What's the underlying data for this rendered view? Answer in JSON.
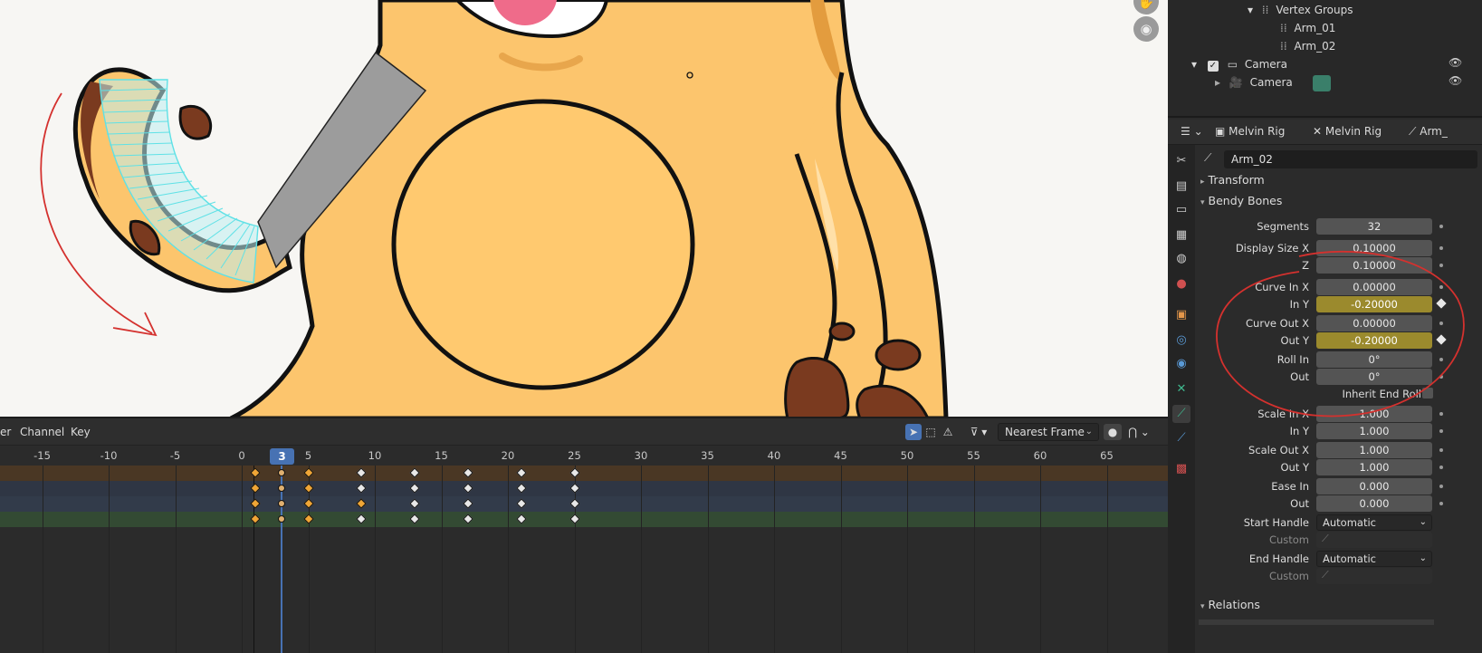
{
  "outliner": {
    "vertex_groups_label": "Vertex Groups",
    "vg_item_1": "Arm_01",
    "vg_item_2": "Arm_02",
    "camera_collection": "Camera",
    "camera_object": "Camera"
  },
  "properties_header": {
    "crumb_1": "Melvin Rig",
    "crumb_2": "Melvin Rig",
    "crumb_3": "Arm_"
  },
  "bone": {
    "name": "Arm_02"
  },
  "panels": {
    "transform": "Transform",
    "bendy_bones": "Bendy Bones",
    "relations": "Relations"
  },
  "bendy": {
    "segments_label": "Segments",
    "segments": "32",
    "display_size_x_label": "Display Size X",
    "display_size_x": "0.10000",
    "z_label": "Z",
    "z": "0.10000",
    "curve_in_x_label": "Curve In X",
    "curve_in_x": "0.00000",
    "curve_in_y_label": "In Y",
    "curve_in_y": "-0.20000",
    "curve_out_x_label": "Curve Out X",
    "curve_out_x": "0.00000",
    "curve_out_y_label": "Out Y",
    "curve_out_y": "-0.20000",
    "roll_in_label": "Roll In",
    "roll_in": "0°",
    "roll_out_label": "Out",
    "roll_out": "0°",
    "inherit_end_roll_label": "Inherit End Roll",
    "scale_in_x_label": "Scale In X",
    "scale_in_x": "1.000",
    "scale_in_y_label": "In Y",
    "scale_in_y": "1.000",
    "scale_out_x_label": "Scale Out X",
    "scale_out_x": "1.000",
    "scale_out_y_label": "Out Y",
    "scale_out_y": "1.000",
    "ease_in_label": "Ease In",
    "ease_in": "0.000",
    "ease_out_label": "Out",
    "ease_out": "0.000",
    "start_handle_label": "Start Handle",
    "start_handle": "Automatic",
    "start_custom_label": "Custom",
    "end_handle_label": "End Handle",
    "end_handle": "Automatic",
    "end_custom_label": "Custom"
  },
  "timeline": {
    "menu_partial": "er",
    "menu_channel": "Channel",
    "menu_key": "Key",
    "snap_mode": "Nearest Frame",
    "current_frame": "3",
    "ticks": [
      "-15",
      "-10",
      "-5",
      "0",
      "5",
      "10",
      "15",
      "20",
      "25",
      "30",
      "35",
      "40",
      "45",
      "50",
      "55",
      "60",
      "65"
    ]
  },
  "colors": {
    "accent": "#4772b3",
    "animated_field": "#9b8a2d",
    "keyframe_selected": "#f0a636",
    "keyframe": "#e8e8e8",
    "bone_tab": "#3fb88e"
  }
}
